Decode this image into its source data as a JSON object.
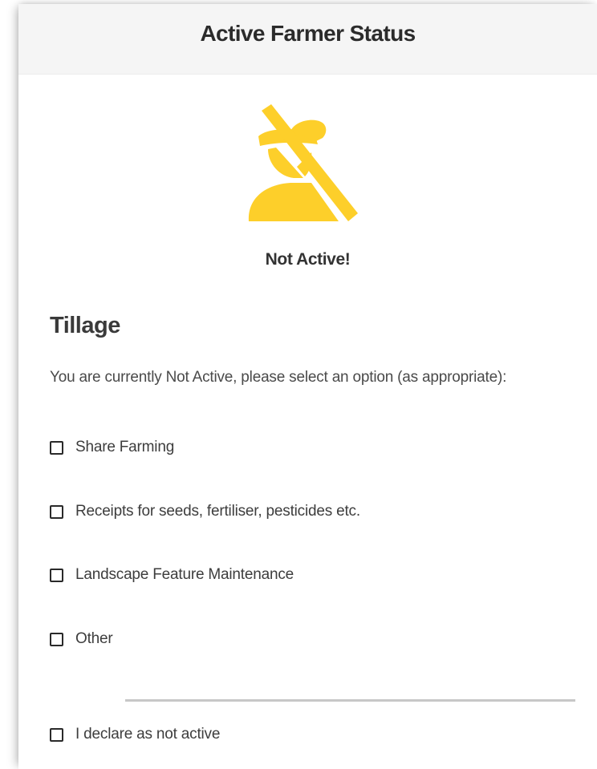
{
  "header": {
    "title": "Active Farmer Status"
  },
  "status": {
    "icon": "farmer-not-active-icon",
    "icon_color": "#fdcf2a",
    "text": "Not Active!"
  },
  "section": {
    "title": "Tillage",
    "instruction": "You are currently Not Active, please select an option (as appropriate):"
  },
  "options": [
    {
      "label": "Share Farming",
      "checked": false
    },
    {
      "label": "Receipts for seeds, fertiliser, pesticides etc.",
      "checked": false
    },
    {
      "label": "Landscape Feature Maintenance",
      "checked": false
    },
    {
      "label": "Other",
      "checked": false
    }
  ],
  "declaration": {
    "label": "I declare as not active",
    "checked": false
  }
}
